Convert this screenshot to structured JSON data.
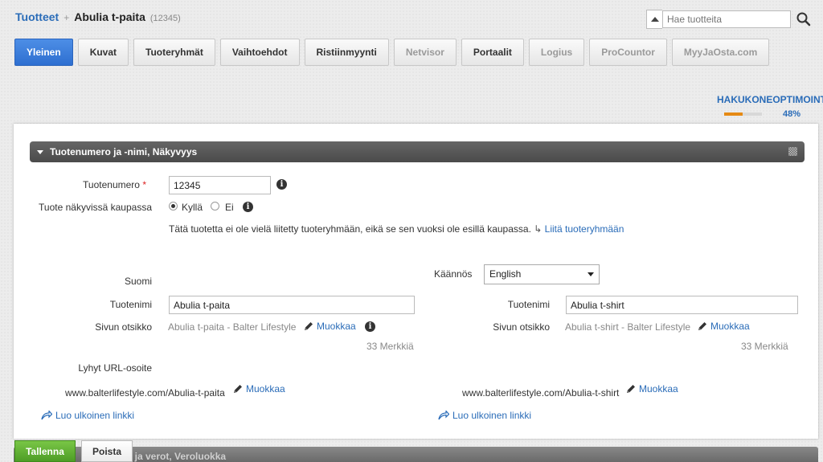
{
  "breadcrumb": {
    "parent": "Tuotteet",
    "separator": "+",
    "title": "Abulia t-paita",
    "id": "(12345)"
  },
  "search": {
    "placeholder": "Hae tuotteita"
  },
  "tabs": [
    {
      "label": "Yleinen",
      "state": "active"
    },
    {
      "label": "Kuvat",
      "state": "normal"
    },
    {
      "label": "Tuoteryhmät",
      "state": "normal"
    },
    {
      "label": "Vaihtoehdot",
      "state": "normal"
    },
    {
      "label": "Ristiinmyynti",
      "state": "normal"
    },
    {
      "label": "Netvisor",
      "state": "disabled"
    },
    {
      "label": "Portaalit",
      "state": "normal"
    },
    {
      "label": "Logius",
      "state": "disabled"
    },
    {
      "label": "ProCountor",
      "state": "disabled"
    },
    {
      "label": "MyyJaOsta.com",
      "state": "disabled"
    }
  ],
  "seo": {
    "label": "HAKUKONEOPTIMOINTI",
    "percent_text": "48%",
    "percent": 48,
    "bar_color": "#e58a14"
  },
  "section": {
    "title": "Tuotenumero ja -nimi, Näkyvyys"
  },
  "form": {
    "product_number_label": "Tuotenumero",
    "required_mark": "*",
    "product_number_value": "12345",
    "visible_label": "Tuote näkyvissä kaupassa",
    "visible_yes": "Kyllä",
    "visible_no": "Ei",
    "visible_selected": "yes",
    "notice": "Tätä tuotetta ei ole vielä liitetty tuoteryhmään, eikä se sen vuoksi ole esillä kaupassa.",
    "notice_link": "Liitä tuoteryhmään"
  },
  "left_lang": {
    "language": "Suomi",
    "name_label": "Tuotenimi",
    "name_value": "Abulia t-paita",
    "page_title_label": "Sivun otsikko",
    "page_title_value": "Abulia t-paita - Balter Lifestyle",
    "edit_label": "Muokkaa",
    "char_count": "33 Merkkiä",
    "short_url_label": "Lyhyt URL-osoite",
    "url": "www.balterlifestyle.com/Abulia-t-paita",
    "url_edit": "Muokkaa",
    "external_link": "Luo ulkoinen linkki"
  },
  "right_lang": {
    "translation_label": "Käännös",
    "translation_selected": "English",
    "name_label": "Tuotenimi",
    "name_value": "Abulia t-shirt",
    "page_title_label": "Sivun otsikko",
    "page_title_value": "Abulia t-shirt - Balter Lifestyle",
    "edit_label": "Muokkaa",
    "char_count": "33 Merkkiä",
    "url": "www.balterlifestyle.com/Abulia-t-shirt",
    "url_edit": "Muokkaa",
    "external_link": "Luo ulkoinen linkki"
  },
  "footer": {
    "save": "Tallenna",
    "delete": "Poista",
    "next_section": "Hinnat ja verot, Veroluokka"
  },
  "colors": {
    "accent": "#2e6fd0",
    "link": "#2a6cb8",
    "save": "#4e9d26"
  }
}
